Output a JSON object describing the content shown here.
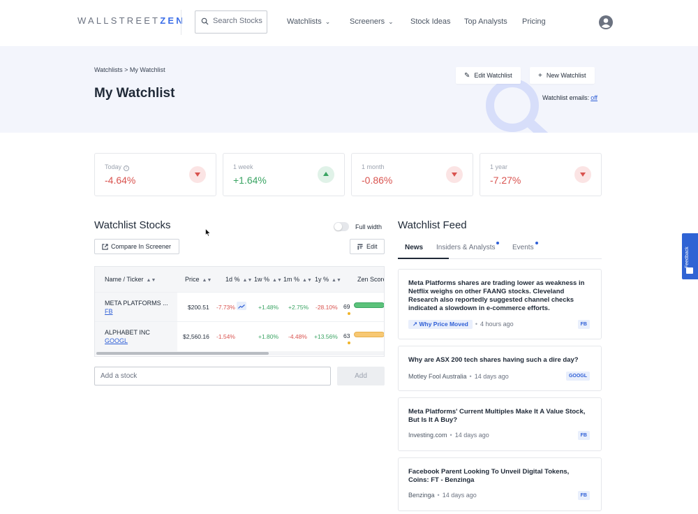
{
  "nav": {
    "logo_light": "WALLSTREET",
    "logo_bold": "ZEN",
    "search_placeholder": "Search Stocks",
    "links": [
      "Watchlists",
      "Screeners",
      "Stock Ideas",
      "Top Analysts",
      "Pricing"
    ]
  },
  "hero": {
    "breadcrumb": "Watchlists > My Watchlist",
    "title": "My Watchlist",
    "edit_label": "Edit Watchlist",
    "new_label": "New Watchlist",
    "emails_label": "Watchlist emails:",
    "emails_value": "off"
  },
  "stats": [
    {
      "label": "Today",
      "value": "-4.64%",
      "direction": "down"
    },
    {
      "label": "1 week",
      "value": "+1.64%",
      "direction": "up"
    },
    {
      "label": "1 month",
      "value": "-0.86%",
      "direction": "down"
    },
    {
      "label": "1 year",
      "value": "-7.27%",
      "direction": "down"
    }
  ],
  "stocks": {
    "title": "Watchlist Stocks",
    "full_width_label": "Full width",
    "compare_label": "Compare In Screener",
    "edit_label": "Edit",
    "columns": [
      "Name / Ticker",
      "Price",
      "1d %",
      "1w %",
      "1m %",
      "1y %",
      "Zen Score"
    ],
    "rows": [
      {
        "name": "META PLATFORMS ...",
        "ticker": "FB",
        "price": "$200.51",
        "d1": "-7.73%",
        "w1": "+1.48%",
        "m1": "+2.75%",
        "y1": "-28.10%",
        "zen": "69"
      },
      {
        "name": "ALPHABET INC",
        "ticker": "GOOGL",
        "price": "$2,560.16",
        "d1": "-1.54%",
        "w1": "+1.80%",
        "m1": "-4.48%",
        "y1": "+13.56%",
        "zen": "63"
      }
    ],
    "add_placeholder": "Add a stock",
    "add_label": "Add"
  },
  "feed": {
    "title": "Watchlist Feed",
    "tabs": [
      "News",
      "Insiders & Analysts",
      "Events"
    ],
    "items": [
      {
        "headline": "Meta Platforms shares are trading lower as weakness in Netflix weighs on other FAANG stocks. Cleveland Research also reportedly suggested channel checks indicated a slowdown in e-commerce efforts.",
        "source": "Why Price Moved",
        "ago": "4 hours ago",
        "ticker": "FB"
      },
      {
        "headline": "Why are ASX 200 tech shares having such a dire day?",
        "source": "Motley Fool Australia",
        "ago": "14 days ago",
        "ticker": "GOOGL"
      },
      {
        "headline": "Meta Platforms' Current Multiples Make It A Value Stock, But Is It A Buy?",
        "source": "Investing.com",
        "ago": "14 days ago",
        "ticker": "FB"
      },
      {
        "headline": "Facebook Parent Looking To Unveil Digital Tokens, Coins: FT - Benzinga",
        "source": "Benzinga",
        "ago": "14 days ago",
        "ticker": "FB"
      }
    ]
  },
  "feedback_label": "Feedback",
  "colors": {
    "accent": "#2f5fd6",
    "negative": "#d9534f",
    "positive": "#3aa463",
    "zen_good": "#5cc27a",
    "zen_mid": "#f7c873"
  }
}
